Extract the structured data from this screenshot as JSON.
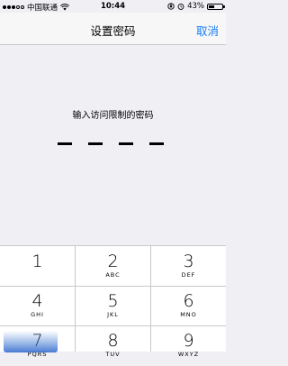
{
  "status_bar": {
    "carrier": "中国联通",
    "time": "10:44",
    "battery_percent": "43%",
    "battery_level": 0.43
  },
  "nav": {
    "title": "设置密码",
    "cancel_label": "取消"
  },
  "prompt": "输入访问限制的密码",
  "passcode": {
    "length": 4,
    "entered": 0
  },
  "keypad": [
    {
      "num": "1",
      "letters": ""
    },
    {
      "num": "2",
      "letters": "ABC"
    },
    {
      "num": "3",
      "letters": "DEF"
    },
    {
      "num": "4",
      "letters": "GHI"
    },
    {
      "num": "5",
      "letters": "JKL"
    },
    {
      "num": "6",
      "letters": "MNO"
    },
    {
      "num": "7",
      "letters": "PQRS"
    },
    {
      "num": "8",
      "letters": "TUV"
    },
    {
      "num": "9",
      "letters": "WXYZ"
    }
  ],
  "colors": {
    "accent": "#157efb",
    "background": "#efeff4",
    "keypad_bg": "#ffffff",
    "separator": "#c8c7cc"
  }
}
